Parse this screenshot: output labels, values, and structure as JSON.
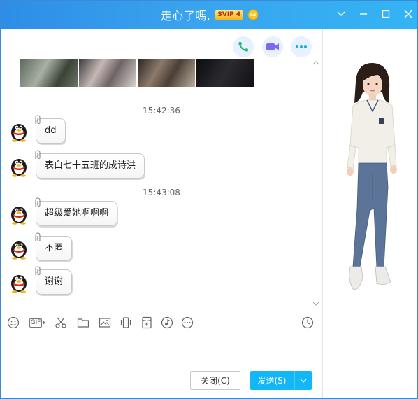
{
  "window": {
    "title": "走心了嗎.",
    "vip_badge": "SVIP 4",
    "controls": [
      "chevron-down",
      "minimize",
      "maximize",
      "close"
    ]
  },
  "call_buttons": [
    "phone-icon",
    "video-icon",
    "more-icon"
  ],
  "messages_section": [
    {
      "timestamp": "15:42:36",
      "messages": [
        "dd",
        "表白七十五班的成诗洪"
      ]
    },
    {
      "timestamp": "15:43:08",
      "messages": [
        "超级爱她啊啊啊",
        "不匿",
        "谢谢"
      ]
    }
  ],
  "toolbar": {
    "gif_label": "GIF",
    "tools": [
      "emoji-icon",
      "gif-icon",
      "scissors-icon",
      "folder-icon",
      "image-icon",
      "shake-icon",
      "red-packet-icon",
      "music-icon",
      "more-icon",
      "history-icon"
    ]
  },
  "buttons": {
    "close_label": "关闭(C)",
    "send_label": "发送(S)"
  },
  "colors": {
    "title_bar": "#2e8de6",
    "send_button": "#12b7f5",
    "call_icon_green": "#2dbb6b",
    "call_icon_purple": "#7b6af0",
    "call_icon_blue": "#1ea8f0"
  }
}
